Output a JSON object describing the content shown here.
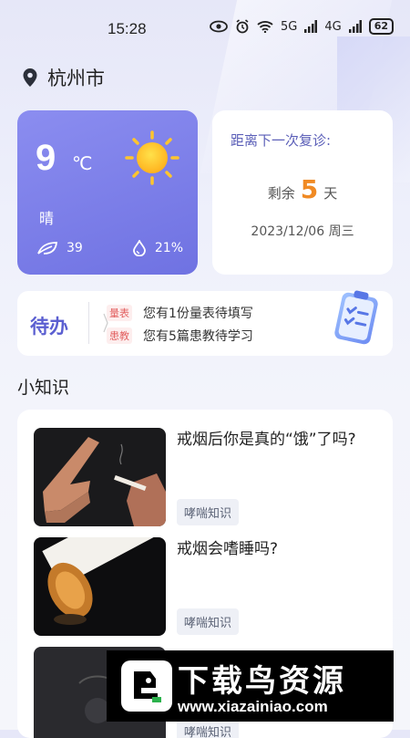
{
  "status_bar": {
    "time": "15:28",
    "signal_1": "5G",
    "signal_2": "4G",
    "battery": "62"
  },
  "location": {
    "city": "杭州市"
  },
  "weather": {
    "temperature": "9",
    "unit": "℃",
    "condition": "晴",
    "aqi": "39",
    "humidity": "21%"
  },
  "visit": {
    "title": "距离下一次复诊:",
    "prefix": "剩余",
    "days": "5",
    "suffix": "天",
    "date": "2023/12/06 周三"
  },
  "todo": {
    "title": "待办",
    "items": [
      {
        "tag": "量表",
        "text": "您有1份量表待填写"
      },
      {
        "tag": "患教",
        "text": "您有5篇患教待学习"
      }
    ]
  },
  "knowledge": {
    "section_title": "小知识",
    "articles": [
      {
        "title": "戒烟后你是真的“饿”了吗?",
        "tag": "哮喘知识"
      },
      {
        "title": "戒烟会嗜睡吗?",
        "tag": "哮喘知识"
      },
      {
        "title": "",
        "tag": "哮喘知识"
      }
    ]
  },
  "watermark": {
    "title": "下载鸟资源",
    "url": "www.xiazainiao.com"
  },
  "colors": {
    "accent": "#6f72e2",
    "orange": "#f08a24",
    "tag_red": "#e26060"
  }
}
